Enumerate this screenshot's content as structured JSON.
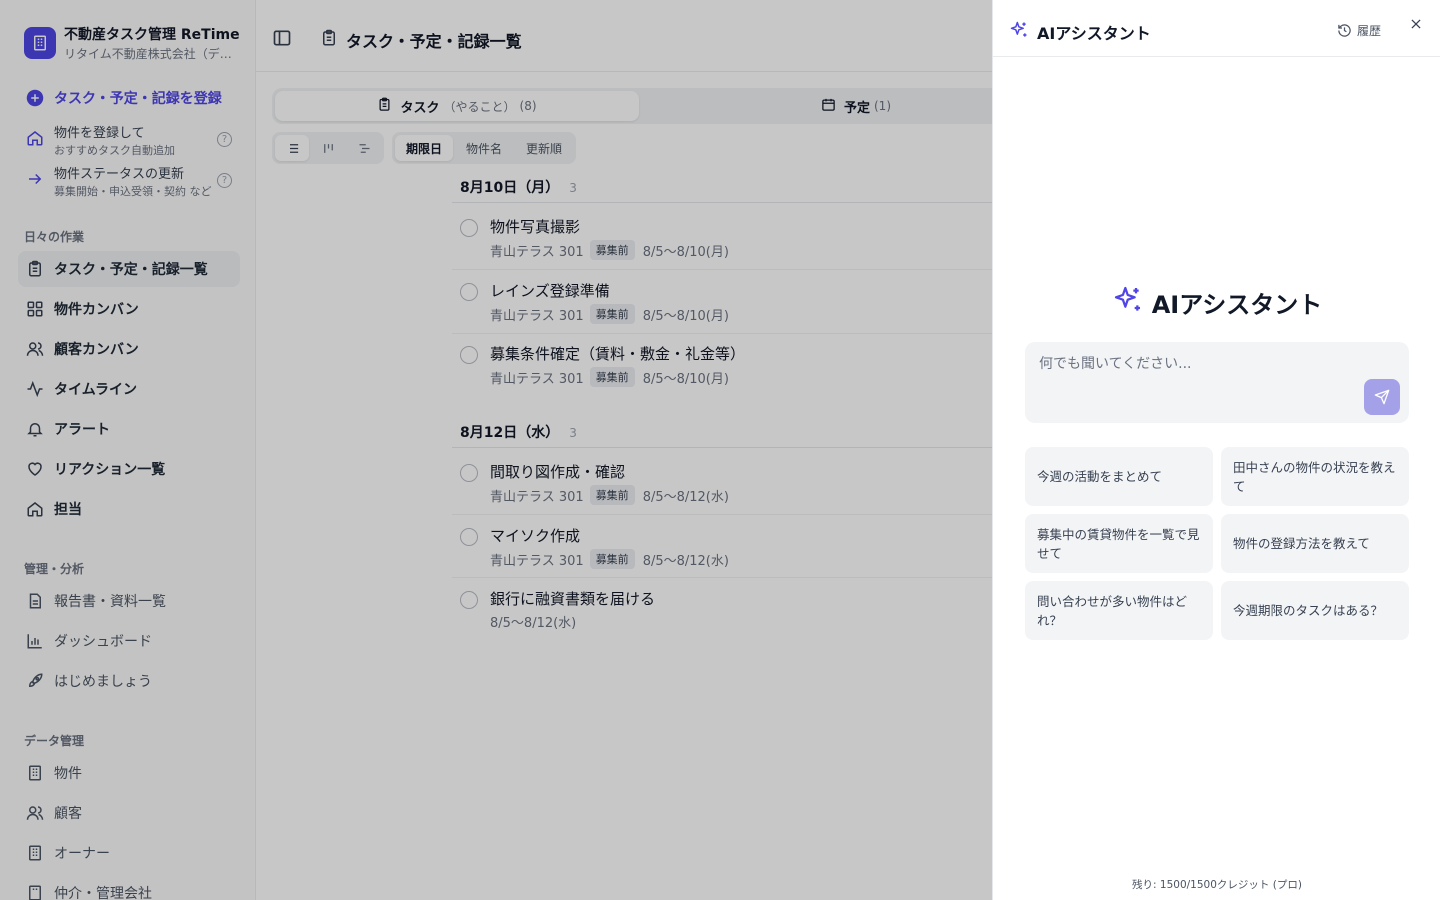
{
  "app": {
    "title": "不動産タスク管理 ReTime",
    "company": "リタイム不動産株式会社（デモ）"
  },
  "colors": {
    "accent": "#4f46e5",
    "send_button": "#a5a1e8",
    "overlay": "rgba(0,0,0,0.22)"
  },
  "sidebar": {
    "register_label": "タスク・予定・記録を登録",
    "quick": [
      {
        "title": "物件を登録して",
        "sub": "おすすめタスク自動追加",
        "icon": "home-icon"
      },
      {
        "title": "物件ステータスの更新",
        "sub": "募集開始・申込受領・契約 など",
        "icon": "arrow-right-icon"
      }
    ],
    "daily_label": "日々の作業",
    "daily": [
      {
        "label": "タスク・予定・記録一覧",
        "icon": "clipboard-icon"
      },
      {
        "label": "物件カンバン",
        "icon": "grid-icon"
      },
      {
        "label": "顧客カンバン",
        "icon": "users-icon"
      },
      {
        "label": "タイムライン",
        "icon": "activity-icon"
      },
      {
        "label": "アラート",
        "icon": "bell-icon"
      },
      {
        "label": "リアクション一覧",
        "icon": "heart-icon"
      },
      {
        "label": "担当",
        "icon": "home-icon"
      }
    ],
    "admin_label": "管理・分析",
    "admin": [
      {
        "label": "報告書・資料一覧",
        "icon": "document-icon"
      },
      {
        "label": "ダッシュボード",
        "icon": "bar-chart-icon"
      },
      {
        "label": "はじめましょう",
        "icon": "rocket-icon"
      }
    ],
    "data_label": "データ管理",
    "data": [
      {
        "label": "物件",
        "icon": "building-icon"
      },
      {
        "label": "顧客",
        "icon": "users-icon"
      },
      {
        "label": "オーナー",
        "icon": "building-icon"
      },
      {
        "label": "仲介・管理会社",
        "icon": "building-icon"
      }
    ]
  },
  "main": {
    "title": "タスク・予定・記録一覧",
    "tabs": [
      {
        "label": "タスク",
        "sub": "（やること）",
        "count": "(8)"
      },
      {
        "label": "予定",
        "sub": "",
        "count": "(1)"
      }
    ],
    "sort": [
      "期限日",
      "物件名",
      "更新順"
    ],
    "groups": [
      {
        "date": "8月10日（月）",
        "count": "3",
        "tasks": [
          {
            "title": "物件写真撮影",
            "property": "青山テラス 301",
            "badge": "募集前",
            "range": "8/5〜8/10(月)"
          },
          {
            "title": "レインズ登録準備",
            "property": "青山テラス 301",
            "badge": "募集前",
            "range": "8/5〜8/10(月)"
          },
          {
            "title": "募集条件確定（賃料・敷金・礼金等）",
            "property": "青山テラス 301",
            "badge": "募集前",
            "range": "8/5〜8/10(月)"
          }
        ]
      },
      {
        "date": "8月12日（水）",
        "count": "3",
        "tasks": [
          {
            "title": "間取り図作成・確認",
            "property": "青山テラス 301",
            "badge": "募集前",
            "range": "8/5〜8/12(水)"
          },
          {
            "title": "マイソク作成",
            "property": "青山テラス 301",
            "badge": "募集前",
            "range": "8/5〜8/12(水)"
          },
          {
            "title": "銀行に融資書類を届ける",
            "property": "",
            "badge": "",
            "range": "8/5〜8/12(水)"
          }
        ]
      }
    ]
  },
  "assistant": {
    "header_title": "AIアシスタント",
    "history_label": "履歴",
    "hero_title": "AIアシスタント",
    "placeholder": "何でも聞いてください...",
    "suggestions": [
      "今週の活動をまとめて",
      "田中さんの物件の状況を教えて",
      "募集中の賃貸物件を一覧で見せて",
      "物件の登録方法を教えて",
      "問い合わせが多い物件はどれ？",
      "今週期限のタスクはある？"
    ],
    "credits": "残り: 1500/1500クレジット (プロ)"
  }
}
